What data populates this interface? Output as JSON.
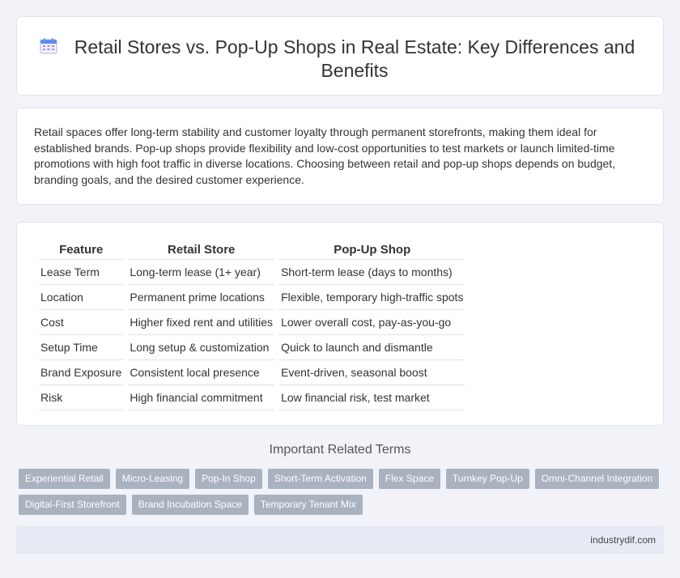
{
  "header": {
    "title": "Retail Stores vs. Pop-Up Shops in Real Estate: Key Differences and Benefits",
    "icon": "calendar-icon"
  },
  "intro": {
    "text": "Retail spaces offer long-term stability and customer loyalty through permanent storefronts, making them ideal for established brands. Pop-up shops provide flexibility and low-cost opportunities to test markets or launch limited-time promotions with high foot traffic in diverse locations. Choosing between retail and pop-up shops depends on budget, branding goals, and the desired customer experience."
  },
  "table": {
    "headers": [
      "Feature",
      "Retail Store",
      "Pop-Up Shop"
    ],
    "rows": [
      [
        "Lease Term",
        "Long-term lease (1+ year)",
        "Short-term lease (days to months)"
      ],
      [
        "Location",
        "Permanent prime locations",
        "Flexible, temporary high-traffic spots"
      ],
      [
        "Cost",
        "Higher fixed rent and utilities",
        "Lower overall cost, pay-as-you-go"
      ],
      [
        "Setup Time",
        "Long setup & customization",
        "Quick to launch and dismantle"
      ],
      [
        "Brand Exposure",
        "Consistent local presence",
        "Event-driven, seasonal boost"
      ],
      [
        "Risk",
        "High financial commitment",
        "Low financial risk, test market"
      ]
    ]
  },
  "related": {
    "title": "Important Related Terms",
    "tags": [
      "Experiential Retail",
      "Micro-Leasing",
      "Pop-In Shop",
      "Short-Term Activation",
      "Flex Space",
      "Turnkey Pop-Up",
      "Omni-Channel Integration",
      "Digital-First Storefront",
      "Brand Incubation Space",
      "Temporary Tenant Mix"
    ]
  },
  "footer": {
    "site": "industrydif.com"
  },
  "colors": {
    "background": "#f1f3f8",
    "tag_bg": "#aab2c0",
    "footer_bg": "#e6ebf5",
    "icon_accent": "#5b8def"
  }
}
